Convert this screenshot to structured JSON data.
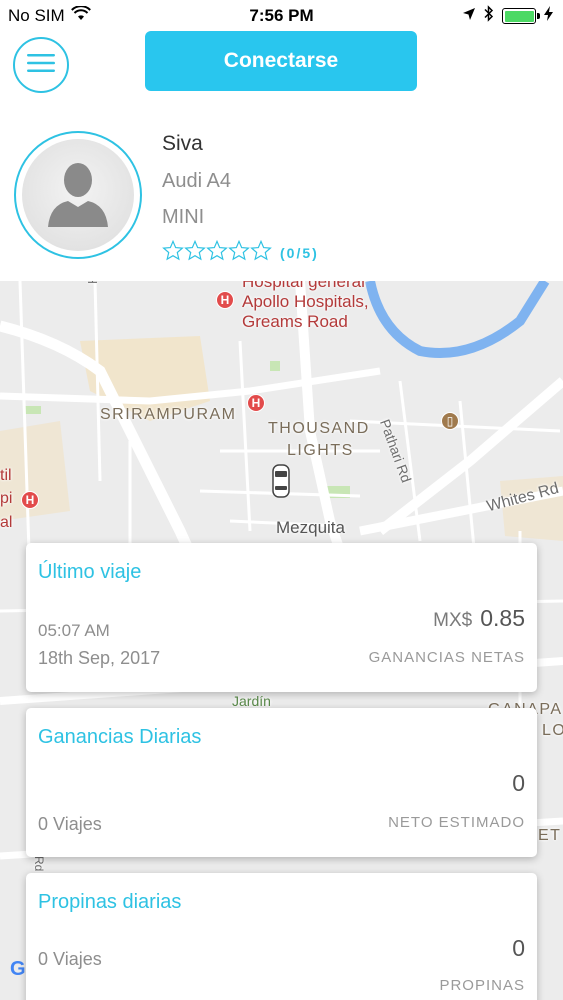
{
  "status_bar": {
    "carrier": "No SIM",
    "time": "7:56 PM"
  },
  "topbar": {
    "connect_label": "Conectarse"
  },
  "profile": {
    "name": "Siva",
    "car": "Audi A4",
    "type": "MINI",
    "rating_text": "(0/5)",
    "rating_value": 0,
    "rating_max": 5
  },
  "map": {
    "labels": {
      "hospital_partial": "Hospital general",
      "hospital_line1": "Apollo Hospitals,",
      "hospital_line2": "Greams Road",
      "srirampuram": "SRIRAMPURAM",
      "thousand": "THOUSAND",
      "lights": "LIGHTS",
      "pathari": "Pathari Rd",
      "whites": "Whites Rd",
      "mezquita": "Mezquita",
      "il": "til",
      "pi": "pi",
      "al": "al",
      "jardin": "Jardín",
      "ganapa": "GANAPA",
      "lo": "LO",
      "et": "ET",
      "rd_left": "Rd",
      "h_top": "Ha"
    },
    "colors": {
      "accent": "#2ec2e3",
      "river": "#7fb3f0"
    }
  },
  "cards": {
    "last_trip": {
      "title": "Último viaje",
      "time": "05:07 AM",
      "date": "18th Sep, 2017",
      "currency": "MX$",
      "amount": "0.85",
      "caption": "GANANCIAS NETAS"
    },
    "daily_earnings": {
      "title": "Ganancias Diarias",
      "amount": "0",
      "trips": "0 Viajes",
      "caption": "NETO ESTIMADO"
    },
    "daily_tips": {
      "title": "Propinas diarias",
      "amount": "0",
      "trips": "0 Viajes",
      "caption": "PROPINAS"
    }
  }
}
